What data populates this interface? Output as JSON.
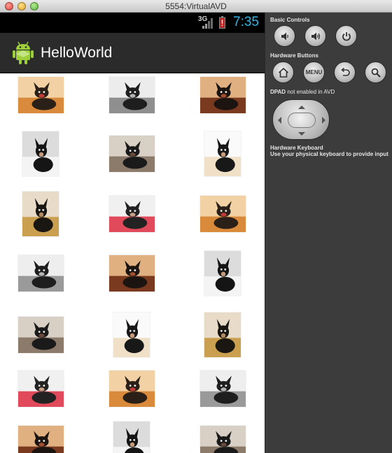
{
  "window": {
    "title": "5554:VirtualAVD"
  },
  "status_bar": {
    "network": "3G",
    "time": "7:35",
    "clock_color": "#33b5e5"
  },
  "app_bar": {
    "title": "HelloWorld",
    "icon": "android-robot-icon"
  },
  "gallery": {
    "columns": 3,
    "items": [
      {
        "subject": "chihuahua in striped sweater, standing",
        "icon": "dog-photo-thumbnail"
      },
      {
        "subject": "chihuahua lying on couch",
        "icon": "dog-photo-thumbnail"
      },
      {
        "subject": "chihuahua face close-up",
        "icon": "dog-photo-thumbnail"
      },
      {
        "subject": "chihuahua sitting, portrait",
        "icon": "dog-photo-thumbnail"
      },
      {
        "subject": "chihuahua on plaid bed",
        "icon": "dog-photo-thumbnail"
      },
      {
        "subject": "chihuahua face close-up",
        "icon": "dog-photo-thumbnail"
      },
      {
        "subject": "chihuahua standing on carpet",
        "icon": "dog-photo-thumbnail"
      },
      {
        "subject": "chihuahua on red pillow",
        "icon": "dog-photo-thumbnail"
      },
      {
        "subject": "chihuahua in striped sweater",
        "icon": "dog-photo-thumbnail"
      },
      {
        "subject": "chihuahua lying on couch",
        "icon": "dog-photo-thumbnail"
      },
      {
        "subject": "chihuahua face close-up",
        "icon": "dog-photo-thumbnail"
      },
      {
        "subject": "chihuahua sitting, portrait",
        "icon": "dog-photo-thumbnail"
      },
      {
        "subject": "chihuahua on plaid bed",
        "icon": "dog-photo-thumbnail"
      },
      {
        "subject": "chihuahua face close-up",
        "icon": "dog-photo-thumbnail"
      },
      {
        "subject": "chihuahua standing on carpet",
        "icon": "dog-photo-thumbnail"
      },
      {
        "subject": "chihuahua on red pillow",
        "icon": "dog-photo-thumbnail"
      },
      {
        "subject": "chihuahua in striped sweater",
        "icon": "dog-photo-thumbnail"
      },
      {
        "subject": "chihuahua lying on couch",
        "icon": "dog-photo-thumbnail"
      },
      {
        "subject": "chihuahua face close-up",
        "icon": "dog-photo-thumbnail"
      },
      {
        "subject": "chihuahua sitting, portrait",
        "icon": "dog-photo-thumbnail"
      },
      {
        "subject": "chihuahua on plaid bed",
        "icon": "dog-photo-thumbnail"
      }
    ]
  },
  "controls": {
    "basic_label": "Basic Controls",
    "basic_buttons": [
      {
        "name": "volume-down-button",
        "icon": "volume-down-icon"
      },
      {
        "name": "volume-up-button",
        "icon": "volume-up-icon"
      },
      {
        "name": "power-button",
        "icon": "power-icon"
      }
    ],
    "hardware_label": "Hardware Buttons",
    "hardware_buttons": [
      {
        "name": "home-button",
        "icon": "home-icon"
      },
      {
        "name": "menu-button",
        "label": "MENU"
      },
      {
        "name": "back-button",
        "icon": "back-arrow-icon"
      },
      {
        "name": "search-button",
        "icon": "search-icon"
      }
    ],
    "dpad_prefix": "DPAD",
    "dpad_note": "not enabled in AVD",
    "keyboard_label": "Hardware Keyboard",
    "keyboard_desc": "Use your physical keyboard to provide input"
  }
}
